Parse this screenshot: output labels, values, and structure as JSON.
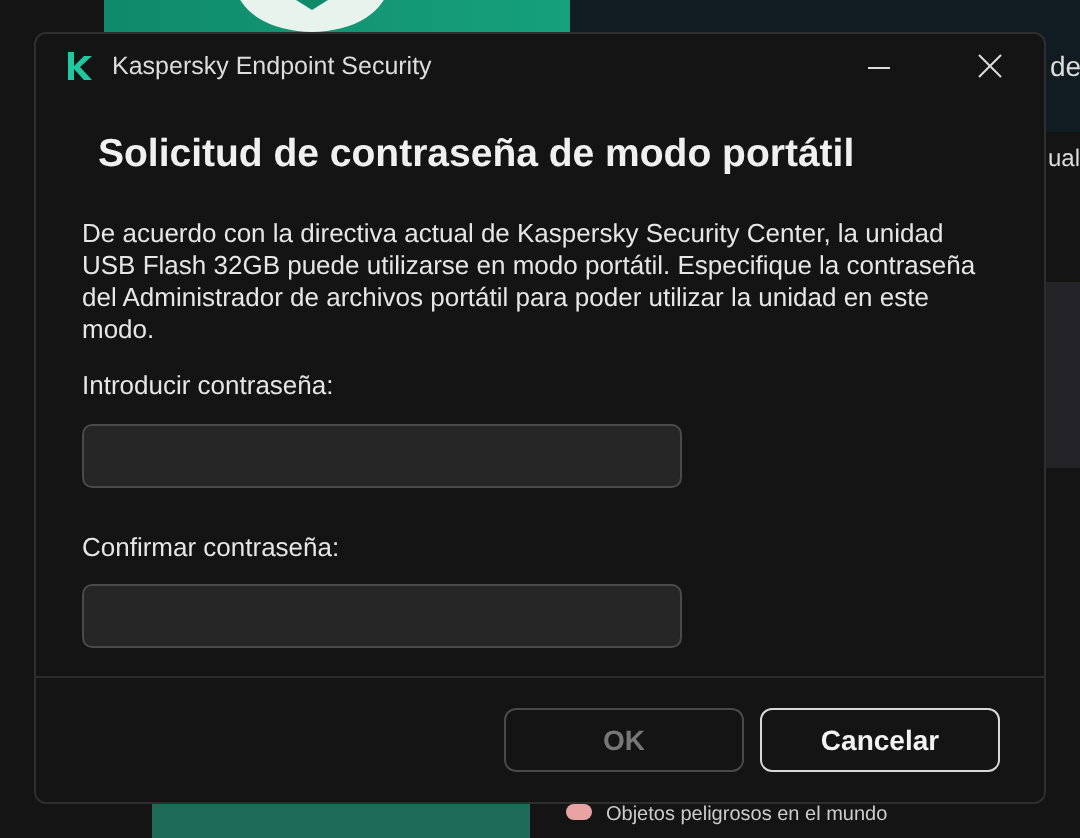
{
  "background": {
    "top_right_text": "de",
    "second_text": "ual",
    "legend": {
      "label": "Objetos peligrosos en el mundo",
      "color": "#e9a3a3"
    }
  },
  "window": {
    "title": "Kaspersky Endpoint Security"
  },
  "dialog": {
    "heading": "Solicitud de contraseña de modo portátil",
    "message": "De acuerdo con la directiva actual de Kaspersky Security Center, la unidad USB Flash 32GB puede utilizarse en modo portátil. Especifique la contraseña del Administrador de archivos portátil para poder utilizar la unidad en este modo.",
    "fields": [
      {
        "label": "Introducir contraseña:"
      },
      {
        "label": "Confirmar contraseña:"
      }
    ],
    "buttons": [
      {
        "label": "OK",
        "disabled": true
      },
      {
        "label": "Cancelar",
        "disabled": false
      }
    ]
  }
}
